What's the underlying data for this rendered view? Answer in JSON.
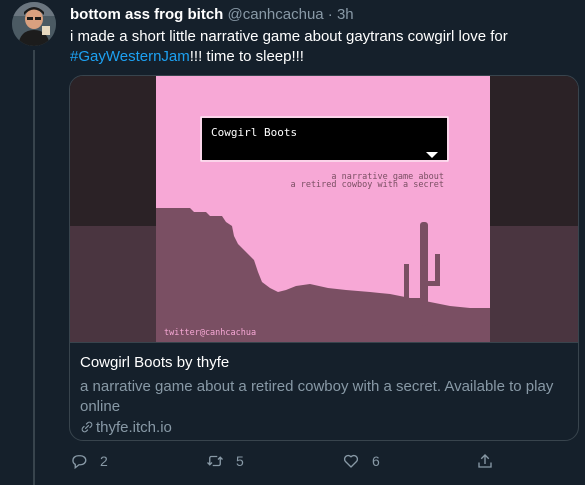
{
  "tweet": {
    "display_name": "bottom ass frog bitch",
    "handle_time": "@canhcachua · 3h",
    "text_before": "i made a short little narrative game about gaytrans cowgirl love for ",
    "hashtag": "#GayWesternJam",
    "text_after": "!!! time to sleep!!!"
  },
  "card": {
    "game": {
      "title_box": "Cowgirl Boots",
      "subtitle_line1": "a narrative game about",
      "subtitle_line2": "a retired cowboy with a secret",
      "credit": "twitter@canhcachua"
    },
    "title": "Cowgirl Boots by thyfe",
    "description": "a narrative game about a retired cowboy with a secret. Available to play online",
    "domain": "thyfe.itch.io"
  },
  "actions": {
    "reply_count": "2",
    "retweet_count": "5",
    "like_count": "6"
  },
  "colors": {
    "background": "#15202b",
    "accent": "#1da1f2",
    "muted": "#8899a6",
    "game_pink": "#f7a8d6",
    "game_mauve": "#7a4f63"
  }
}
